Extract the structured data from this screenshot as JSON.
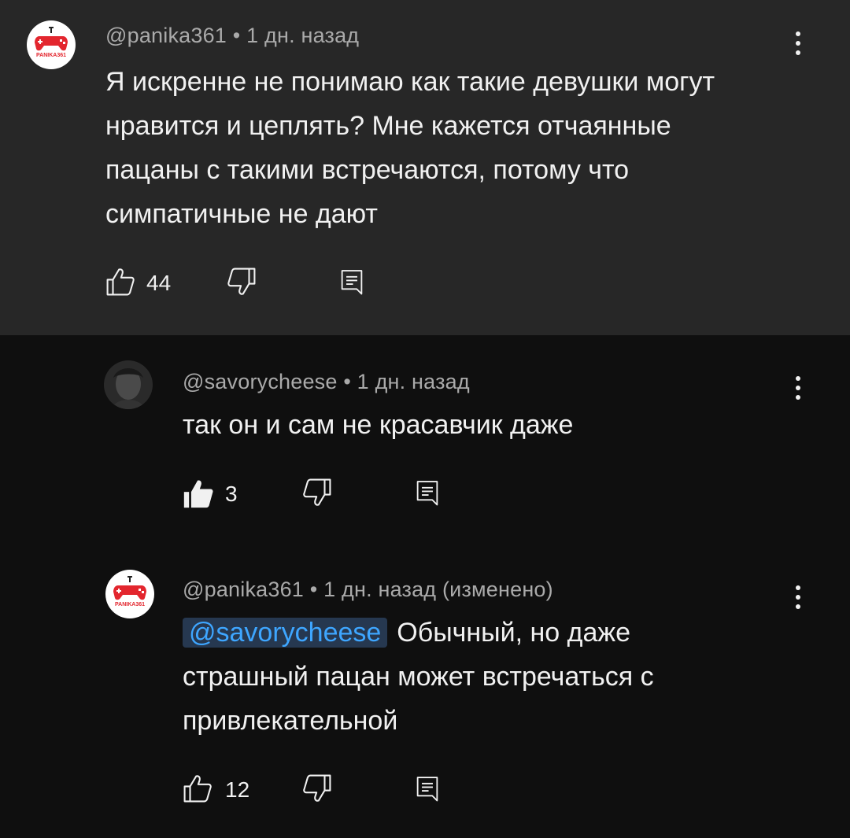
{
  "comments": [
    {
      "author": "@panika361",
      "time": "1 дн. назад",
      "edited": "",
      "avatar_text": "PANIKA361",
      "mention": "",
      "text": "Я искренне не понимаю как такие девушки могут нравится и цеплять? Мне кажется отчаянные пацаны с такими встречаются, потому что симпатичные не дают",
      "likes": "44",
      "liked": false
    },
    {
      "author": "@savorycheese",
      "time": "1 дн. назад",
      "edited": "",
      "mention": "",
      "text": "так он и сам не красавчик даже",
      "likes": "3",
      "liked": true
    },
    {
      "author": "@panika361",
      "time": "1 дн. назад",
      "edited": "(изменено)",
      "avatar_text": "PANIKA361",
      "mention": "@savorycheese",
      "text": "Обычный, но даже страшный пацан может встречаться с привлекательной",
      "likes": "12",
      "liked": false
    }
  ],
  "separator": "•",
  "colors": {
    "background": "#0f0f0f",
    "highlight": "#272727",
    "meta_text": "#aaaaaa",
    "mention": "#3ea6ff",
    "avatar_red": "#e3262e"
  },
  "icons": [
    "like-icon",
    "like-filled-icon",
    "dislike-icon",
    "reply-icon",
    "more-options-icon"
  ]
}
